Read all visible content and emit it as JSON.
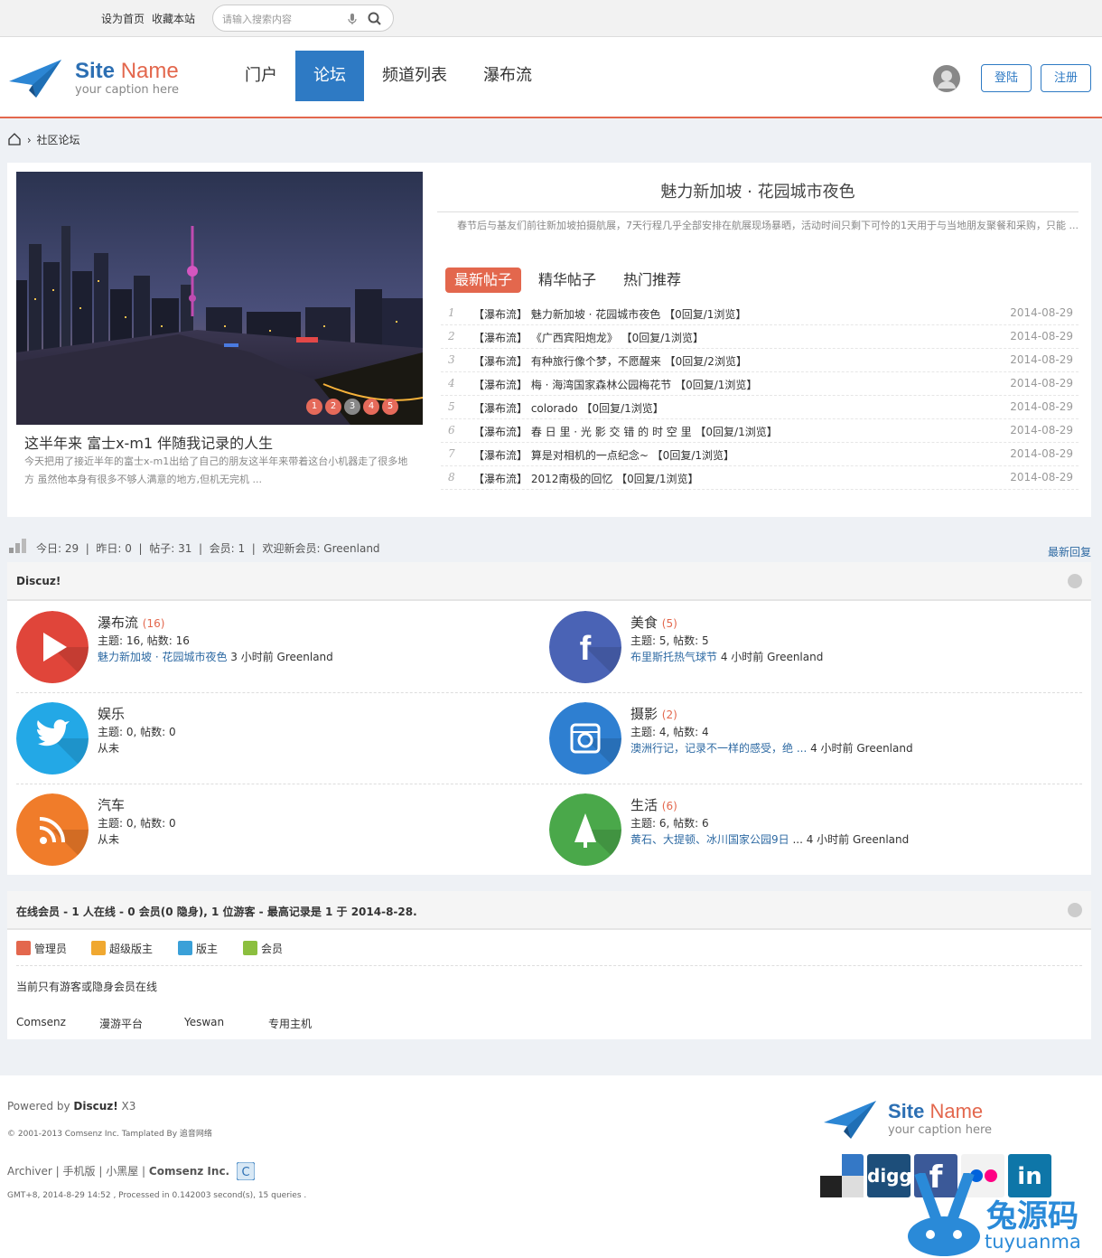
{
  "topbar": {
    "set_home": "设为首页",
    "bookmark": "收藏本站",
    "search_placeholder": "请输入搜索内容"
  },
  "logo": {
    "name_bold": "Site",
    "name_light": "Name",
    "caption": "your caption here"
  },
  "nav": [
    {
      "label": "门户",
      "active": false
    },
    {
      "label": "论坛",
      "active": true
    },
    {
      "label": "频道列表",
      "active": false
    },
    {
      "label": "瀑布流",
      "active": false
    }
  ],
  "auth": {
    "login": "登陆",
    "register": "注册"
  },
  "breadcrumb": {
    "current": "社区论坛"
  },
  "slider": {
    "title": "这半年来 富士x-m1 伴随我记录的人生",
    "desc": "今天把用了接近半年的富士x-m1出给了自己的朋友这半年来带着这台小机器走了很多地方 虽然他本身有很多不够人满意的地方,但机无完机 ...",
    "dots": [
      "1",
      "2",
      "3",
      "4",
      "5"
    ],
    "active_dot": "3"
  },
  "featured": {
    "title": "魅力新加坡 · 花园城市夜色",
    "desc": "春节后与基友们前往新加坡拍摄航展，7天行程几乎全部安排在航展现场暴晒，活动时间只剩下可怜的1天用于与当地朋友聚餐和采购，只能 ..."
  },
  "tabs": [
    {
      "label": "最新帖子",
      "active": true
    },
    {
      "label": "精华帖子",
      "active": false
    },
    {
      "label": "热门推荐",
      "active": false
    }
  ],
  "posts": [
    {
      "n": "1",
      "title": "【瀑布流】 魅力新加坡 · 花园城市夜色 【0回复/1浏览】",
      "date": "2014-08-29"
    },
    {
      "n": "2",
      "title": "【瀑布流】 《广西宾阳炮龙》 【0回复/1浏览】",
      "date": "2014-08-29"
    },
    {
      "n": "3",
      "title": "【瀑布流】 有种旅行像个梦，不愿醒来 【0回复/2浏览】",
      "date": "2014-08-29"
    },
    {
      "n": "4",
      "title": "【瀑布流】 梅 · 海湾国家森林公园梅花节 【0回复/1浏览】",
      "date": "2014-08-29"
    },
    {
      "n": "5",
      "title": "【瀑布流】 colorado 【0回复/1浏览】",
      "date": "2014-08-29"
    },
    {
      "n": "6",
      "title": "【瀑布流】 春 日 里 · 光 影 交 错 的 时 空 里 【0回复/1浏览】",
      "date": "2014-08-29"
    },
    {
      "n": "7",
      "title": "【瀑布流】 算是对相机的一点纪念~ 【0回复/1浏览】",
      "date": "2014-08-29"
    },
    {
      "n": "8",
      "title": "【瀑布流】 2012南极的回忆 【0回复/1浏览】",
      "date": "2014-08-29"
    }
  ],
  "stats": {
    "text": "今日: 29  |  昨日: 0  |  帖子: 31  |  会员: 1  |  欢迎新会员: Greenland",
    "latest_reply": "最新回复"
  },
  "forum_section": {
    "title": "Discuz!"
  },
  "forums": [
    {
      "name": "瀑布流",
      "count": "(16)",
      "meta": "主题: 16, 帖数: 16",
      "last_link": "魅力新加坡 · 花园城市夜色",
      "last_rest": " 3 小时前 Greenland",
      "color": "#e0453a",
      "icon": "play-icon"
    },
    {
      "name": "美食",
      "count": "(5)",
      "meta": "主题: 5, 帖数: 5",
      "last_link": "布里斯托热气球节",
      "last_rest": " 4 小时前 Greenland",
      "color": "#4a63b5",
      "icon": "facebook-icon"
    },
    {
      "name": "娱乐",
      "count": "",
      "meta": "主题: 0, 帖数: 0",
      "last_link": "",
      "last_rest": "从未",
      "color": "#23a8e6",
      "icon": "twitter-icon"
    },
    {
      "name": "摄影",
      "count": "(2)",
      "meta": "主题: 4, 帖数: 4",
      "last_link": "澳洲行记，记录不一样的感受，绝 ...",
      "last_rest": " 4 小时前 Greenland",
      "color": "#2e7fd1",
      "icon": "camera-icon"
    },
    {
      "name": "汽车",
      "count": "",
      "meta": "主题: 0, 帖数: 0",
      "last_link": "",
      "last_rest": "从未",
      "color": "#f07c2a",
      "icon": "rss-icon"
    },
    {
      "name": "生活",
      "count": "(6)",
      "meta": "主题: 6, 帖数: 6",
      "last_link": "黄石、大提顿、冰川国家公园9日",
      "last_rest": " ... 4 小时前 Greenland",
      "color": "#4aa84a",
      "icon": "tree-icon"
    }
  ],
  "online": {
    "title": "在线会员 - 1 人在线 - 0 会员(0 隐身), 1 位游客 - 最高记录是 1 于 2014-8-28.",
    "legend": [
      "管理员",
      "超级版主",
      "版主",
      "会员"
    ],
    "note": "当前只有游客或隐身会员在线"
  },
  "links": [
    "Comsenz",
    "漫游平台",
    "Yeswan",
    "专用主机"
  ],
  "footer": {
    "powered": "Powered by ",
    "brand": "Discuz!",
    "version": " X3",
    "copyright": "© 2001-2013 Comsenz Inc.  Tamplated By 追音网络",
    "links": [
      "Archiver",
      "手机版",
      "小黑屋"
    ],
    "company": "Comsenz Inc.",
    "time": "GMT+8, 2014-8-29 14:52 , Processed in 0.142003 second(s), 15 queries .",
    "social": [
      "delicious",
      "digg",
      "facebook",
      "flickr",
      "linkedin"
    ],
    "watermark_cn": "兔源码",
    "watermark_en": "tuyuanma"
  }
}
